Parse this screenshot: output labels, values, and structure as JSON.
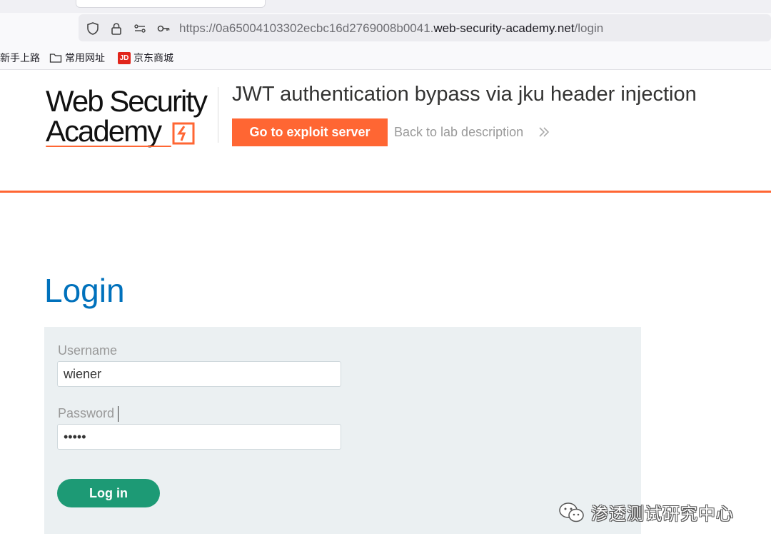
{
  "browser": {
    "url_prefix": "https://0a65004103302ecbc16d2769008b0041.",
    "url_domain": "web-security-academy.net",
    "url_path": "/login",
    "bookmarks": [
      {
        "label": "新手上路",
        "icon": "none"
      },
      {
        "label": "常用网址",
        "icon": "folder-icon"
      },
      {
        "label": "京东商城",
        "icon": "jd-icon",
        "badge": "JD"
      }
    ]
  },
  "header": {
    "logo_line1": "Web Security",
    "logo_line2": "Academy",
    "lab_title": "JWT authentication bypass via jku header injection",
    "exploit_button": "Go to exploit server",
    "back_link": "Back to lab description",
    "accent_color": "#ff6633"
  },
  "login": {
    "title": "Login",
    "username_label": "Username",
    "username_value": "wiener",
    "password_label": "Password",
    "password_value": "•••••",
    "submit_label": "Log in",
    "title_color": "#0071bc",
    "button_color": "#1d9a75"
  },
  "watermark": {
    "text": "渗透测试研究中心",
    "icon": "wechat-icon"
  }
}
